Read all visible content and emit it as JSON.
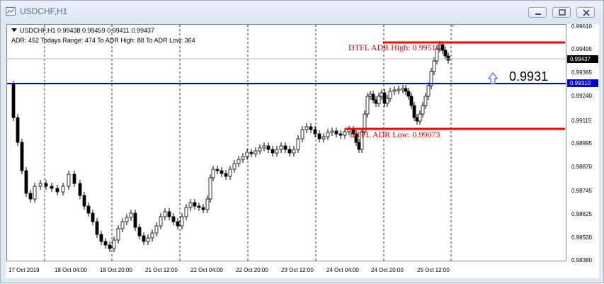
{
  "window": {
    "title": "USDCHF,H1",
    "controls": [
      "minimize",
      "restore",
      "close"
    ]
  },
  "chart": {
    "symbol_line": "USDCHF,H1  0.99438 0.99459 0.99411 0.99437",
    "adr_line": "ADR: 452  Todays Range: 474  To ADR High: 88  To ADR Low: 364",
    "adr_high_label": "DTFL ADR High: 0.99510",
    "adr_low_label": "DTFL ADR Low: 0.99073",
    "level_label": "0.9931",
    "colors": {
      "adr_lines": "#ff0000",
      "level_line": "#0000cc",
      "bull_candle": "#ffffff",
      "bear_candle": "#000000"
    }
  },
  "price_axis": {
    "ticks": [
      "0.99610",
      "0.99495",
      "0.99365",
      "0.99240",
      "0.99115",
      "0.98995",
      "0.98870",
      "0.98745",
      "0.98625",
      "0.98500",
      "0.98380"
    ],
    "current_price_tag": "0.99437",
    "level_tag": "0.99310"
  },
  "time_axis": {
    "ticks": [
      "17 Oct 2019",
      "18 Oct 04:00",
      "18 Oct 20:00",
      "21 Oct 12:00",
      "22 Oct 04:00",
      "22 Oct 20:00",
      "23 Oct 12:00",
      "24 Oct 04:00",
      "24 Oct 20:00",
      "25 Oct 12:00"
    ]
  }
}
